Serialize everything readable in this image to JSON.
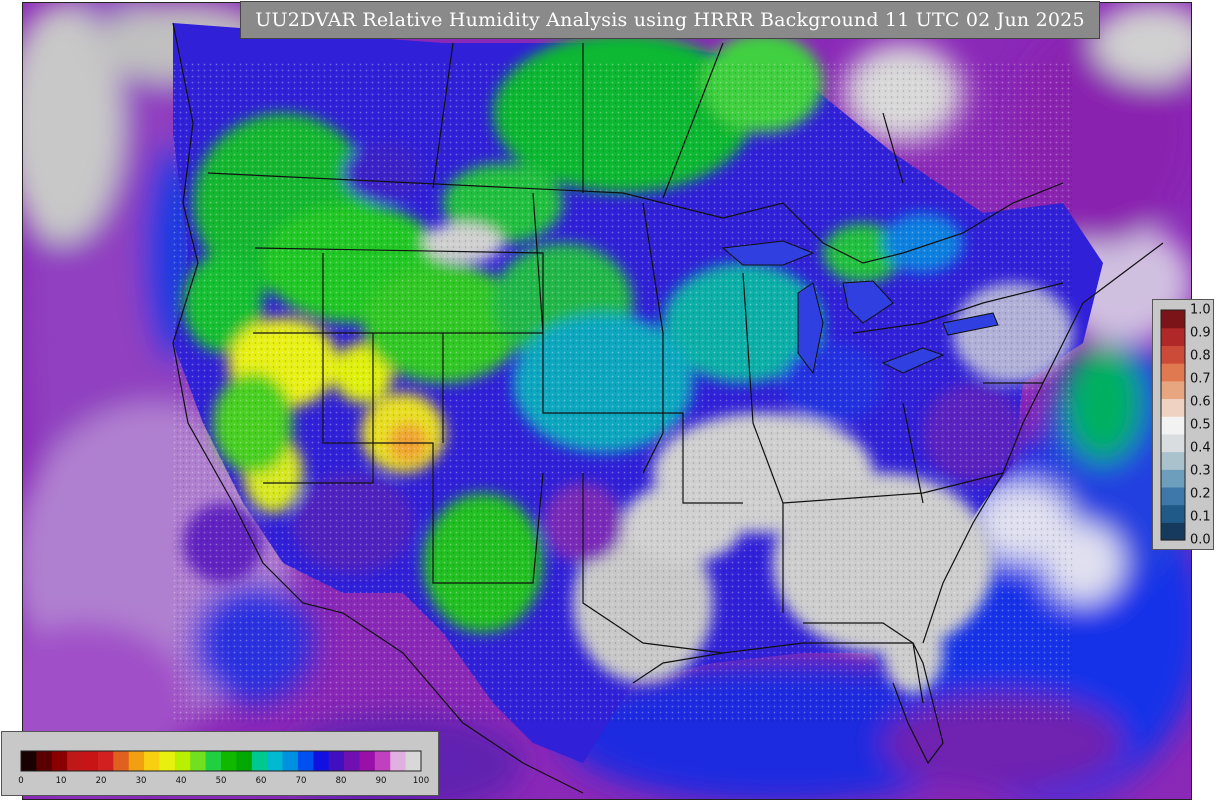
{
  "title": "UU2DVAR Relative Humidity Analysis using HRRR Background 11 UTC 02 Jun 2025",
  "rh_colorbar": {
    "tick_labels": [
      "0",
      "10",
      "20",
      "30",
      "40",
      "50",
      "60",
      "70",
      "80",
      "90",
      "100"
    ],
    "colors": [
      "#1a0000",
      "#5a0000",
      "#8a0000",
      "#c01818",
      "#c81414",
      "#d02020",
      "#e06020",
      "#f0a010",
      "#f8d010",
      "#e8f010",
      "#b8f000",
      "#70e020",
      "#20d040",
      "#10b800",
      "#00a800",
      "#00c890",
      "#00b8d0",
      "#0090e0",
      "#0050f0",
      "#1010e0",
      "#4010c0",
      "#7010b0",
      "#9810a8",
      "#c040c0",
      "#e0b0e0",
      "#d8d8d8"
    ]
  },
  "obs_colorbar": {
    "tick_labels": [
      "0.0",
      "0.1",
      "0.2",
      "0.3",
      "0.4",
      "0.5",
      "0.6",
      "0.7",
      "0.8",
      "0.9",
      "1.0"
    ],
    "colors": [
      "#163a5e",
      "#1f5a88",
      "#3d78a8",
      "#6d9fbd",
      "#a9c2cc",
      "#d9dde0",
      "#f2f2f2",
      "#f0d2c2",
      "#e8a680",
      "#e07850",
      "#cc4a38",
      "#b02828",
      "#7a1418"
    ]
  },
  "map_colors": {
    "ocean_purple": "#7d1cb0",
    "ocean_blue": "#1530e8",
    "land_green": "#18c830",
    "land_teal": "#08b0a8",
    "dry_yellow": "#e8f018",
    "dry_orange": "#f0a030",
    "saturated_gray": "#cdcdcd",
    "boundary": "#111111"
  }
}
